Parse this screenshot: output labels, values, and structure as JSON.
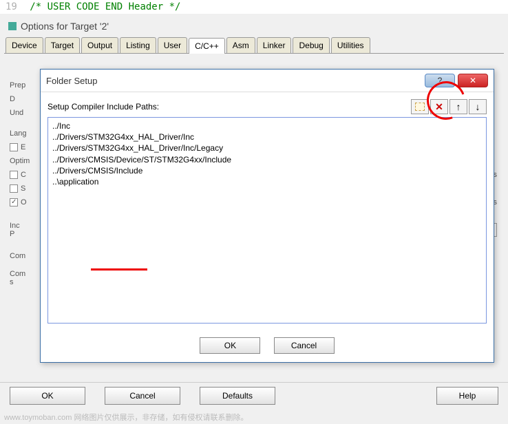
{
  "code": {
    "line_number": "19",
    "text": "/* USER CODE END Header */"
  },
  "window": {
    "title": "Options for Target '2'"
  },
  "tabs": [
    "Device",
    "Target",
    "Output",
    "Listing",
    "User",
    "C/C++",
    "Asm",
    "Linker",
    "Debug",
    "Utilities"
  ],
  "active_tab": "C/C++",
  "bg_panel": {
    "prep": "Prep",
    "d": "D",
    "und": "Und",
    "lang": "Lang",
    "e": "E",
    "optim": "Optim",
    "c": "C",
    "s": "S",
    "o": "O",
    "inc_p": "Inc\nP",
    "com": "Com",
    "com_s": "Com\ns",
    "des": "des",
    "ns": "ns",
    "dots": "..."
  },
  "modal": {
    "title": "Folder Setup",
    "help_glyph": "?",
    "close_glyph": "✕",
    "setup_label": "Setup Compiler Include Paths:",
    "paths": [
      "../Inc",
      "../Drivers/STM32G4xx_HAL_Driver/Inc",
      "../Drivers/STM32G4xx_HAL_Driver/Inc/Legacy",
      "../Drivers/CMSIS/Device/ST/STM32G4xx/Include",
      "../Drivers/CMSIS/Include",
      "..\\application"
    ],
    "ok": "OK",
    "cancel": "Cancel",
    "tool_delete": "✕",
    "tool_up": "↑",
    "tool_down": "↓"
  },
  "bottom": {
    "ok": "OK",
    "cancel": "Cancel",
    "defaults": "Defaults",
    "help": "Help"
  },
  "watermark": "www.toymoban.com 网络图片仅供展示，非存储，如有侵权请联系删除。"
}
